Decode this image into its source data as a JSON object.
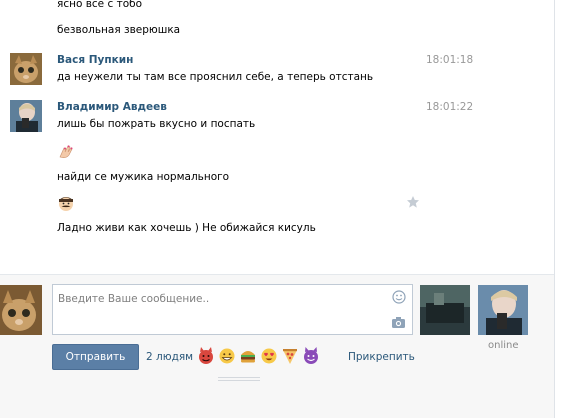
{
  "messages": {
    "prev_line_1": "ясно все с тобо",
    "prev_line_2": "безвольная зверюшка",
    "m1": {
      "author": "Вася Пупкин",
      "time": "18:01:18",
      "text": "да неужели ты там все прояснил себе, а теперь отстань"
    },
    "m2": {
      "author": "Владимир Авдеев",
      "time": "18:01:22",
      "line1": "лишь бы пожрать вкусно и поспать",
      "line2_emoji": "hand-nails-emoji",
      "line3": "найди се мужика нормального",
      "line4_emoji": "mustache-face-emoji",
      "line5": "Ладно живи как хочешь ) Не обижайся кисуль"
    }
  },
  "composer": {
    "placeholder": "Введите Ваше сообщение..",
    "send_label": "Отправить",
    "recipients": "2 людям",
    "attach_label": "Прикрепить",
    "quick_emojis": [
      "devil-face",
      "grin-face",
      "burger",
      "heart-eyes-face",
      "pizza",
      "purple-devil"
    ],
    "online_label": "online"
  },
  "colors": {
    "link": "#2b587a",
    "button": "#5b7fa6",
    "time": "#999999"
  }
}
